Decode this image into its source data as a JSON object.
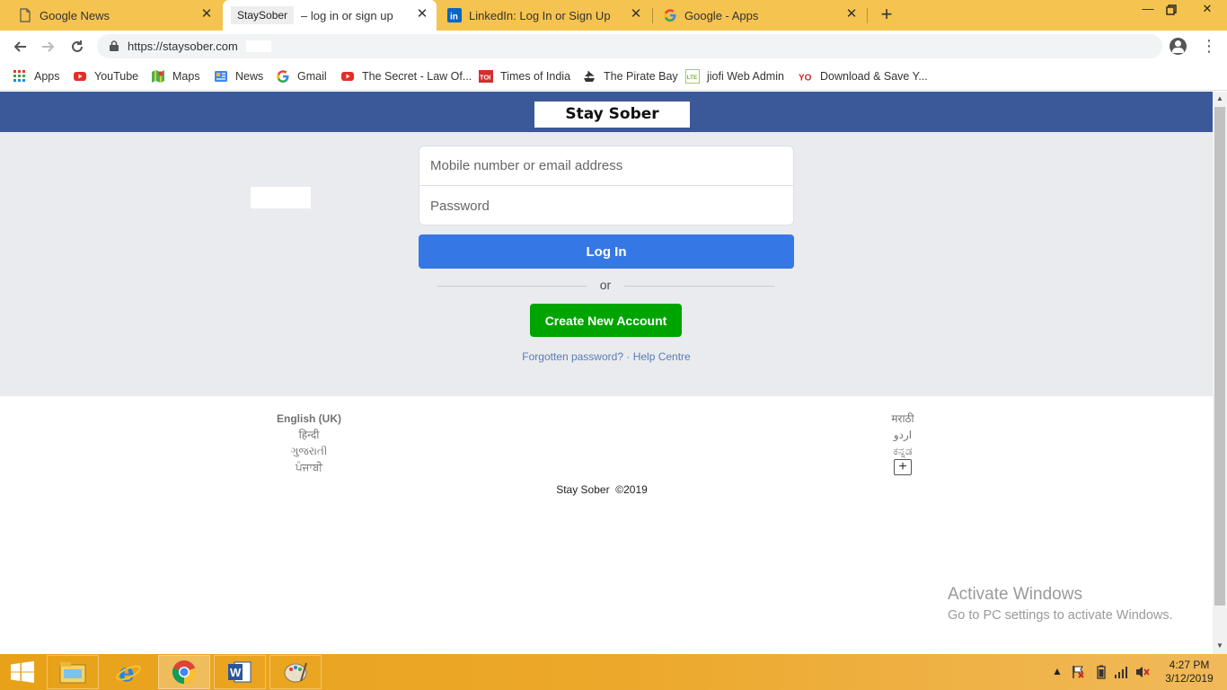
{
  "browser": {
    "tabs": [
      {
        "title": "Google News",
        "favicon": "document-icon"
      },
      {
        "chip": "StaySober",
        "title": "– log in or sign up",
        "active": true
      },
      {
        "title": "LinkedIn: Log In or Sign Up",
        "favicon": "linkedin-icon"
      },
      {
        "title": "Google - Apps",
        "favicon": "google-icon"
      }
    ],
    "url": "https://staysober.com",
    "bookmarks": [
      {
        "label": "Apps",
        "icon": "apps-grid-icon"
      },
      {
        "label": "YouTube",
        "icon": "youtube-icon"
      },
      {
        "label": "Maps",
        "icon": "maps-icon"
      },
      {
        "label": "News",
        "icon": "google-news-icon"
      },
      {
        "label": "Gmail",
        "icon": "google-icon"
      },
      {
        "label": "The Secret - Law Of...",
        "icon": "youtube-icon"
      },
      {
        "label": "Times of India",
        "icon": "toi-icon"
      },
      {
        "label": "The Pirate Bay",
        "icon": "pirate-ship-icon"
      },
      {
        "label": "jiofi Web Admin",
        "icon": "lte-icon"
      },
      {
        "label": "Download & Save Y...",
        "icon": "yo-icon"
      }
    ]
  },
  "page": {
    "brand": "Stay Sober",
    "login": {
      "email_placeholder": "Mobile number or email address",
      "password_placeholder": "Password",
      "login_button": "Log In",
      "or_text": "or",
      "create_button": "Create New Account",
      "forgot_link": "Forgotten password?",
      "separator": "·",
      "help_link": "Help Centre"
    },
    "footer": {
      "languages_left": [
        "English (UK)",
        "हिन्दी",
        "ગુજરાતી",
        "ਪੰਜਾਬੀ"
      ],
      "languages_right": [
        "मराठी",
        "اردو",
        "ಕನ್ನಡ"
      ],
      "more_languages": "+",
      "copyright_name": "Stay Sober",
      "copyright_year": "©2019"
    }
  },
  "watermark": {
    "line1": "Activate Windows",
    "line2": "Go to PC settings to activate Windows."
  },
  "taskbar": {
    "apps": [
      "file-explorer-icon",
      "internet-explorer-icon",
      "chrome-icon",
      "word-icon",
      "paint-icon"
    ],
    "time": "4:27 PM",
    "date": "3/12/2019"
  },
  "colors": {
    "tabstrip": "#f5c34f",
    "header": "#3b5998",
    "page_bg": "#e9ebee",
    "login_button": "#3578e5",
    "create_button": "#00a400",
    "link": "#5b7bb6"
  }
}
